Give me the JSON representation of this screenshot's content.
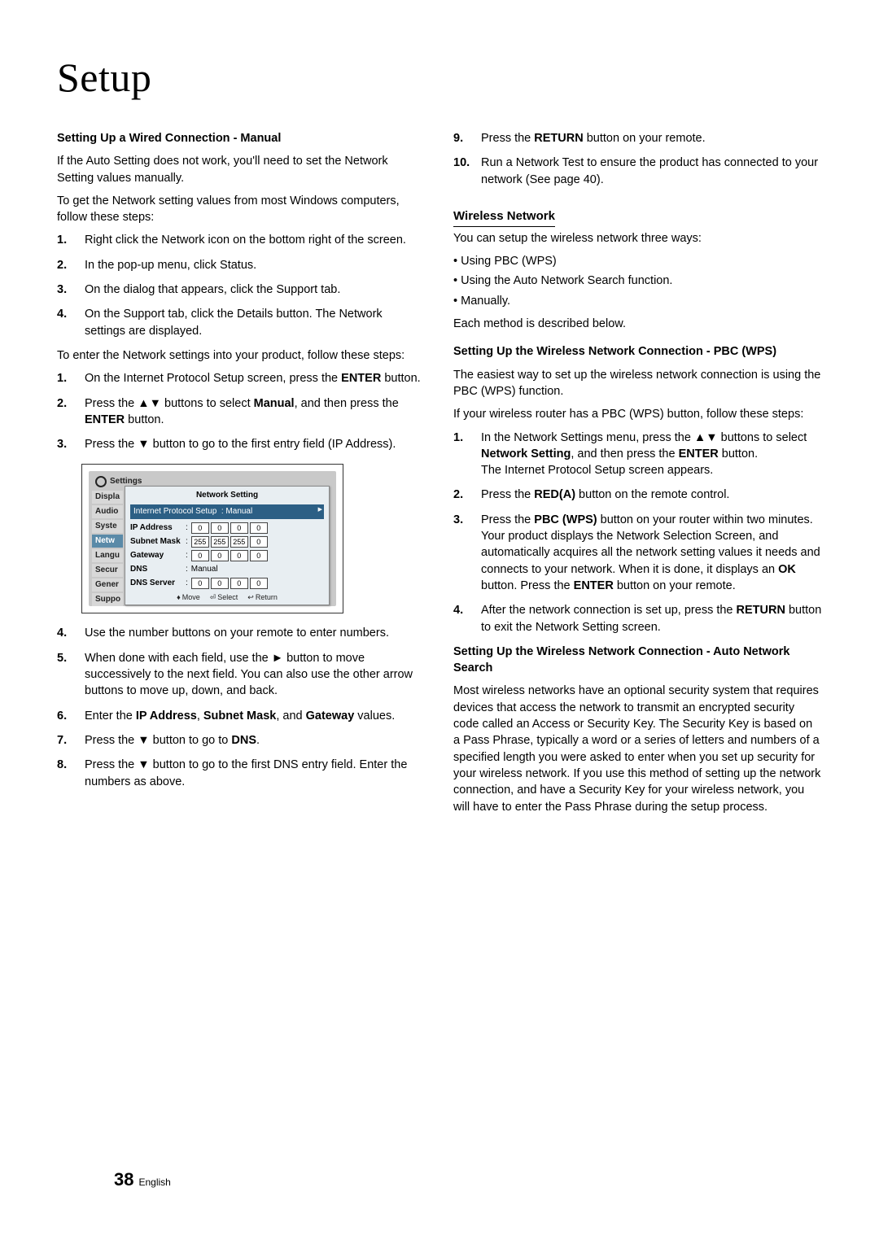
{
  "page_title": "Setup",
  "page_number": "38",
  "page_lang": "English",
  "left": {
    "h1": "Setting Up a Wired Connection - Manual",
    "intro1": "If the Auto Setting does not work, you'll need to set the Network Setting values manually.",
    "intro2": "To get the Network setting values from most Windows computers, follow these steps:",
    "steps_a": [
      "Right click the Network icon on the bottom right of the screen.",
      "In the pop-up menu, click Status.",
      "On the dialog that appears, click the Support tab.",
      "On the Support tab, click the Details button. The Network settings are displayed."
    ],
    "intro3": "To enter the Network settings into your product, follow these steps:",
    "steps_b": [
      "On the Internet Protocol Setup screen, press the ENTER button.",
      "Press the ▲▼ buttons to select Manual, and then press the ENTER button.",
      "Press the ▼ button to go to the first entry field (IP Address)."
    ],
    "steps_c": [
      "Use the number buttons on your remote to enter numbers.",
      "When done with each field, use the ► button to move successively to the next field. You can also use the other arrow buttons to move up, down, and back.",
      "Enter the IP Address, Subnet Mask, and Gateway values.",
      "Press the ▼ button to go to DNS.",
      "Press the ▼ button to go to the first DNS entry field. Enter the numbers as above."
    ]
  },
  "right": {
    "steps_top": [
      "Press the RETURN button on your remote.",
      "Run a Network Test to ensure the product has connected to your network (See page 40)."
    ],
    "h_wireless": "Wireless Network",
    "wireless_intro": "You can setup the wireless network three ways:",
    "wireless_bullets": [
      "Using PBC (WPS)",
      "Using the Auto Network Search function.",
      "Manually."
    ],
    "wireless_each": "Each method is described below.",
    "h_pbc": "Setting Up the Wireless Network Connection - PBC (WPS)",
    "pbc_intro1": "The easiest way to set up the wireless network connection is using the PBC (WPS) function.",
    "pbc_intro2": "If your wireless router has a PBC (WPS) button, follow these steps:",
    "pbc_steps": [
      "In the Network Settings menu, press the ▲▼ buttons to select Network Setting, and then press the ENTER button. The Internet Protocol Setup screen appears.",
      "Press the RED(A) button on the remote control.",
      "Press the PBC (WPS) button on your router within two minutes. Your product displays the Network Selection Screen, and automatically acquires all the network setting values it needs and connects to your network. When it is done, it displays an OK button. Press the ENTER button on your remote.",
      "After the network connection is set up, press the RETURN button to exit the Network Setting screen."
    ],
    "h_auto": "Setting Up the Wireless Network Connection - Auto Network Search",
    "auto_body": "Most wireless networks have an optional security system that requires devices that access the network to transmit an encrypted security code called an Access or Security Key. The Security Key is based on a Pass Phrase, typically a word or a series of letters and numbers of a specified length you were asked to enter when you set up security for your wireless network. If you use this method of setting up the network connection, and have a Security Key for your wireless network, you will have to enter the Pass Phrase during the setup process."
  },
  "panel": {
    "title": "Settings",
    "sidebar": [
      "Displa",
      "Audio",
      "Syste",
      "Netw",
      "Langu",
      "Secur",
      "Gener",
      "Suppo"
    ],
    "dialog_title": "Network Setting",
    "proto_label": "Internet Protocol Setup",
    "proto_value": "Manual",
    "fields": [
      {
        "label": "IP Address",
        "vals": [
          "0",
          "0",
          "0",
          "0"
        ]
      },
      {
        "label": "Subnet Mask",
        "vals": [
          "255",
          "255",
          "255",
          "0"
        ]
      },
      {
        "label": "Gateway",
        "vals": [
          "0",
          "0",
          "0",
          "0"
        ]
      }
    ],
    "dns_label": "DNS",
    "dns_value": "Manual",
    "dns_server": {
      "label": "DNS Server",
      "vals": [
        "0",
        "0",
        "0",
        "0"
      ]
    },
    "footer": [
      "> Move",
      "s Select",
      "r Return"
    ],
    "footer_disp": {
      "move": "Move",
      "select": "Select",
      "return": "Return"
    }
  }
}
